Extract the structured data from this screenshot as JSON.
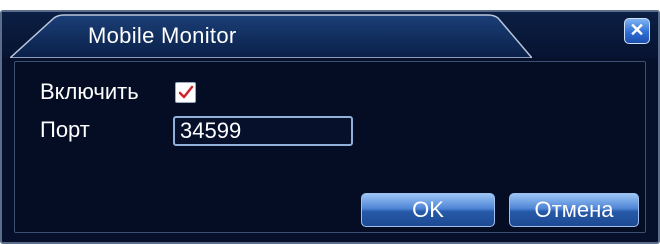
{
  "dialog": {
    "title": "Mobile Monitor",
    "close_symbol": "✕"
  },
  "form": {
    "enable_label": "Включить",
    "enable_checked": true,
    "port_label": "Порт",
    "port_value": "34599"
  },
  "buttons": {
    "ok_label": "OK",
    "cancel_label": "Отмена"
  },
  "colors": {
    "background": "#06102a",
    "accent": "#2f6fd6",
    "check": "#d0242a"
  },
  "icons": {
    "close": "close-icon",
    "check": "checkmark-icon"
  }
}
